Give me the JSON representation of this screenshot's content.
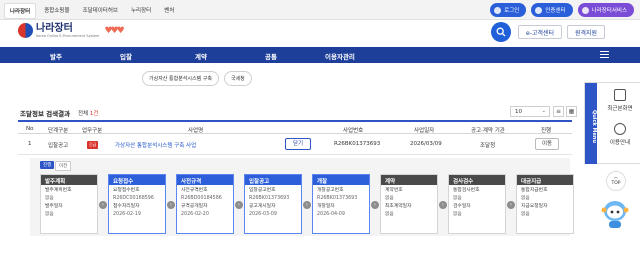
{
  "topbar": {
    "links": [
      "나라장터",
      "종합쇼핑몰",
      "조달데이터허브",
      "누리장터",
      "벤처"
    ],
    "login": "로그인",
    "cert_center": "인증센터",
    "service": "나라장터서비스"
  },
  "header": {
    "logo_main": "나라장터",
    "logo_sub": "공공조달관리시스템",
    "logo_en": "Korea Online E-Procurement System",
    "customer_center": "e-고객센터",
    "remote_support": "원격지원"
  },
  "nav": [
    "발주",
    "입찰",
    "계약",
    "공통",
    "이용자관리"
  ],
  "chips": [
    "가상자산 통합분석시스템 구축",
    "국세청"
  ],
  "results": {
    "title": "조달정보 검색결과",
    "count_prefix": "전체",
    "count_value": "1건",
    "perpage": "10"
  },
  "table": {
    "headers": [
      "No",
      "단계구분",
      "업무구분",
      "사업명",
      "사업번호",
      "사업일자",
      "공고·계약 기관",
      "진행"
    ],
    "row": {
      "no": "1",
      "stage": "입찰공고",
      "badge": "긴급",
      "name": "가상자산 통합분석시스템 구축 사업",
      "close": "닫기",
      "number": "R26BK01373693",
      "date": "2026/03/09",
      "agency": "조달청",
      "move": "이동"
    }
  },
  "panel": {
    "tag_current": "진행",
    "tag_prev": "이전",
    "stages": [
      {
        "title": "발주계획",
        "lines": [
          "발주계획번호",
          "없음",
          "발주일자",
          "없음"
        ]
      },
      {
        "title": "요청접수",
        "lines": [
          "요청접수번호",
          "R26DC00168596",
          "접수처리일자",
          "2026-02-19"
        ]
      },
      {
        "title": "사전규격",
        "lines": [
          "사전규격번호",
          "R26BD00184586",
          "규격공개일자",
          "2026-02-20"
        ]
      },
      {
        "title": "입찰공고",
        "lines": [
          "입찰공고번호",
          "R26BK01373693",
          "공고게시일자",
          "2026-03-09"
        ]
      },
      {
        "title": "개찰",
        "lines": [
          "개찰공고번호",
          "R26BK01373693",
          "개찰일자",
          "2026-04-09"
        ]
      },
      {
        "title": "계약",
        "lines": [
          "계약번호",
          "없음",
          "최초계약일자",
          "없음"
        ]
      },
      {
        "title": "검사검수",
        "lines": [
          "통합검사번호",
          "없음",
          "검수일자",
          "없음"
        ]
      },
      {
        "title": "대금지급",
        "lines": [
          "통합지급번호",
          "없음",
          "지급요청일자",
          "없음"
        ]
      }
    ]
  },
  "quick": {
    "tab": "Quick Menu",
    "items": [
      "최근본화면",
      "이용안내"
    ],
    "top": "TOP"
  },
  "colors": {
    "brand_blue": "#1d3f9a",
    "accent_blue": "#2d55c6",
    "urgent_red": "#d9342b"
  }
}
